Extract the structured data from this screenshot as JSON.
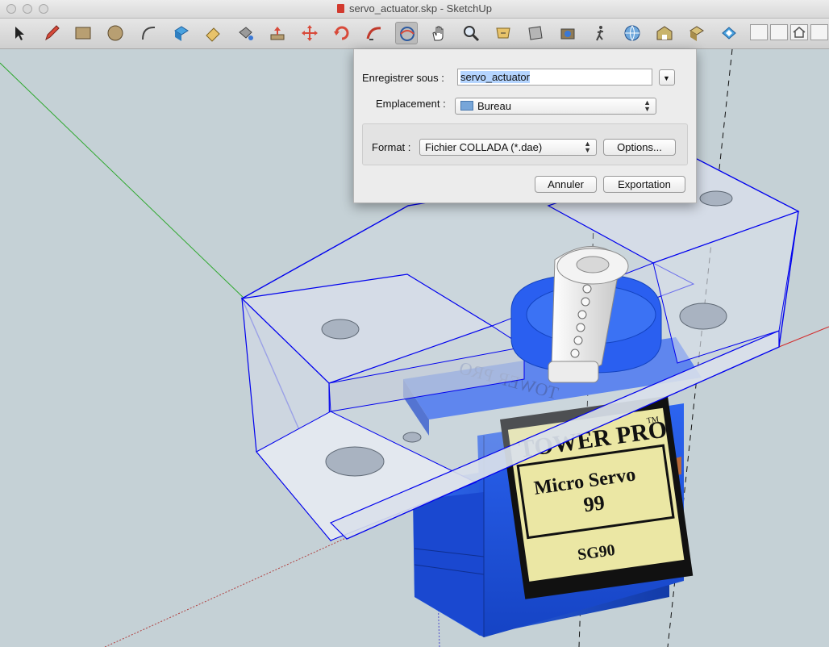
{
  "window": {
    "title": "servo_actuator.skp - SketchUp"
  },
  "toolbar": {
    "tools": [
      {
        "name": "select-tool",
        "icon": "arrow-icon"
      },
      {
        "name": "pencil-tool",
        "icon": "pencil-icon"
      },
      {
        "name": "rectangle-tool",
        "icon": "rectangle-icon"
      },
      {
        "name": "circle-tool",
        "icon": "circle-icon"
      },
      {
        "name": "arc-tool",
        "icon": "arc-icon"
      },
      {
        "name": "make-component-tool",
        "icon": "component-icon"
      },
      {
        "name": "eraser-tool",
        "icon": "eraser-icon"
      },
      {
        "name": "paint-bucket-tool",
        "icon": "paint-bucket-icon"
      },
      {
        "name": "push-pull-tool",
        "icon": "push-pull-icon"
      },
      {
        "name": "move-tool",
        "icon": "move-icon"
      },
      {
        "name": "rotate-tool",
        "icon": "rotate-icon"
      },
      {
        "name": "follow-me-tool",
        "icon": "follow-me-icon"
      },
      {
        "name": "orbit-tool",
        "icon": "orbit-icon",
        "active": true
      },
      {
        "name": "pan-tool",
        "icon": "hand-icon"
      },
      {
        "name": "zoom-tool",
        "icon": "magnifier-icon"
      },
      {
        "name": "zoom-extents-tool",
        "icon": "zoom-extents-icon"
      },
      {
        "name": "previous-view-tool",
        "icon": "previous-view-icon"
      },
      {
        "name": "position-camera-tool",
        "icon": "camera-icon"
      },
      {
        "name": "walk-tool",
        "icon": "walk-icon"
      },
      {
        "name": "share-model-tool",
        "icon": "globe-icon"
      },
      {
        "name": "get-models-tool",
        "icon": "warehouse-icon"
      },
      {
        "name": "share-component-tool",
        "icon": "share-component-icon"
      },
      {
        "name": "extension-tool",
        "icon": "extension-icon"
      }
    ]
  },
  "dialog": {
    "save_as_label": "Enregistrer sous :",
    "filename_value": "servo_actuator",
    "location_label": "Emplacement :",
    "location_value": "Bureau",
    "format_label": "Format :",
    "format_value": "Fichier COLLADA (*.dae)",
    "options_button": "Options...",
    "cancel_button": "Annuler",
    "export_button": "Exportation"
  },
  "model": {
    "label_brand": "TOWER PRO",
    "label_trademark": "TM",
    "label_line1": "Micro Servo",
    "label_line2": "99",
    "label_model": "SG90",
    "mirrored_text": "TOWER PRO"
  },
  "colors": {
    "sky": "#c5d1d6",
    "servo_blue": "#1f56e0",
    "bracket_fill": "#d3dbe6",
    "selection_blue": "#0000ee",
    "axis_green": "#2fa82f",
    "axis_red": "#d22828",
    "label_yellow": "#ebe7a4"
  }
}
